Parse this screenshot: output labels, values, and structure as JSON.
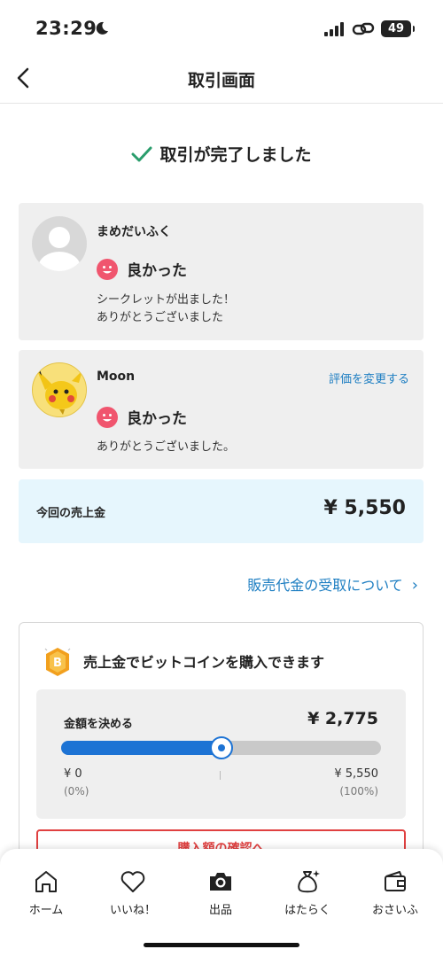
{
  "status_bar": {
    "time": "23:29",
    "battery": "49"
  },
  "nav": {
    "title": "取引画面"
  },
  "complete_message": "取引が完了しました",
  "reviews": [
    {
      "name": "まめだいふく",
      "rating": "良かった",
      "comment": [
        "シークレットが出ました！",
        "ありがとうございました"
      ]
    },
    {
      "name": "Moon",
      "rating": "良かった",
      "comment": [
        "ありがとうございました。"
      ],
      "action": "評価を変更する"
    }
  ],
  "sales": {
    "label": "今回の売上金",
    "amount": "¥ 5,550"
  },
  "receive_link": {
    "label": "販売代金の受取について",
    "chevron": "›"
  },
  "bitcoin": {
    "title": "売上金でビットコインを購入できます",
    "amount_label": "金額を決める",
    "amount_value": "¥ 2,775",
    "slider_fraction": 0.5,
    "min_value": "¥ 0",
    "min_percent": "(0%)",
    "max_value": "¥ 5,550",
    "max_percent": "(100%)",
    "confirm_label": "購入額の確認へ"
  },
  "tabs": [
    {
      "label": "ホーム",
      "icon": "home-icon"
    },
    {
      "label": "いいね！",
      "icon": "heart-icon"
    },
    {
      "label": "出品",
      "icon": "camera-icon"
    },
    {
      "label": "はたらく",
      "icon": "money-bag-icon"
    },
    {
      "label": "おさいふ",
      "icon": "wallet-icon"
    }
  ],
  "colors": {
    "accent": "#1d73d4",
    "link": "#1d7ec2",
    "check": "#2a9d6c",
    "rating": "#f0556e",
    "danger": "#e04040"
  }
}
